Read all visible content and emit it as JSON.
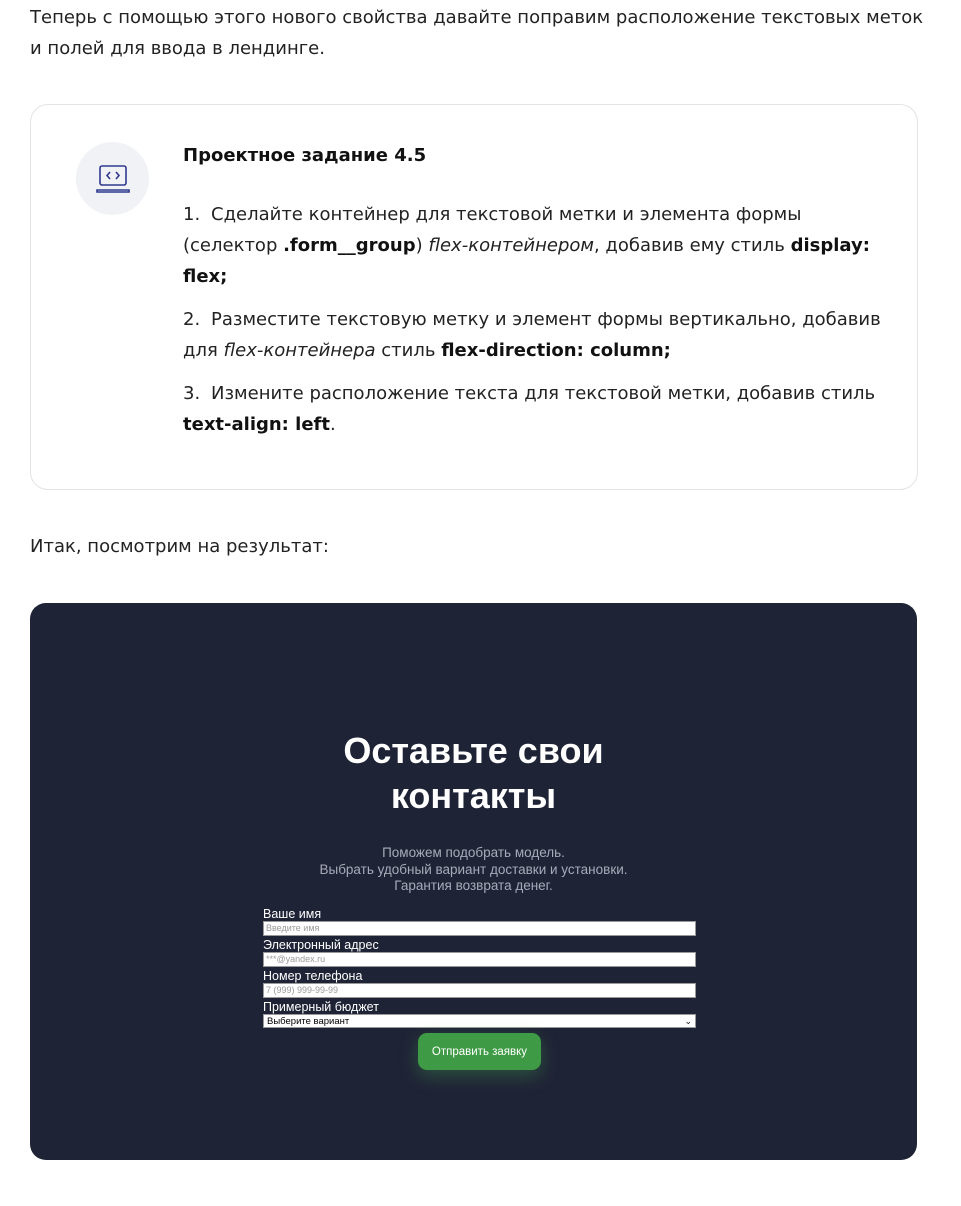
{
  "intro_text": "Теперь с помощью этого нового свойства давайте поправим расположение текстовых меток и полей для ввода в лендинге.",
  "task": {
    "icon": "code-laptop-icon",
    "title": "Проектное задание 4.5",
    "items": [
      {
        "num": "1.",
        "t1": "Сделайте контейнер для текстовой метки и элемента формы (селектор ",
        "b1": ".form__group",
        "t2": ") ",
        "i1": "flex-контейнером",
        "t3": ", добавив ему стиль ",
        "b2": "display: flex;"
      },
      {
        "num": "2.",
        "t1": "Разместите текстовую метку и элемент формы вертикально, добавив для ",
        "i1": "flex-контейнера",
        "t2": " стиль ",
        "b1": "flex-direction: column;"
      },
      {
        "num": "3.",
        "t1": "Измените расположение текста для текстовой метки, добавив стиль ",
        "b1": "text-align: left",
        "t2": "."
      }
    ]
  },
  "outro_text": "Итак, посмотрим на результат:",
  "preview": {
    "background": "#1f2336",
    "title_line1": "Оставьте свои",
    "title_line2": "контакты",
    "subtitle_lines": [
      "Поможем подобрать модель.",
      "Выбрать удобный вариант доставки и установки.",
      "Гарантия возврата денег."
    ],
    "fields": [
      {
        "label": "Ваше имя",
        "placeholder": "Введите имя"
      },
      {
        "label": "Электронный адрес",
        "placeholder": "***@yandex.ru"
      },
      {
        "label": "Номер телефона",
        "placeholder": "7 (999) 999-99-99"
      }
    ],
    "select_label": "Примерный бюджет",
    "select_value": "Выберите вариант",
    "submit_label": "Отправить заявку",
    "submit_color": "#3f9a45"
  }
}
